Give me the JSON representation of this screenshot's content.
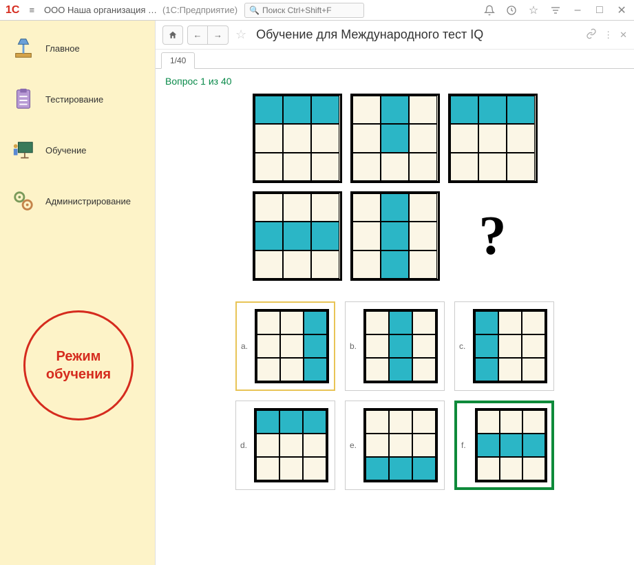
{
  "titlebar": {
    "logo": "1C",
    "org_title": "ООО Наша организация …",
    "app_suffix": "(1С:Предприятие)",
    "search_placeholder": "Поиск Ctrl+Shift+F"
  },
  "sidebar": {
    "items": [
      {
        "label": "Главное"
      },
      {
        "label": "Тестирование"
      },
      {
        "label": "Обучение"
      },
      {
        "label": "Администрирование"
      }
    ],
    "mode_badge_line1": "Режим",
    "mode_badge_line2": "обучения"
  },
  "toolbar": {
    "page_title": "Обучение для Международного тест IQ"
  },
  "tabs": {
    "active": "1/40"
  },
  "question": {
    "label": "Вопрос 1 из 40",
    "grids": [
      [
        1,
        1,
        1,
        0,
        0,
        0,
        0,
        0,
        0
      ],
      [
        0,
        1,
        0,
        0,
        1,
        0,
        0,
        0,
        0
      ],
      [
        1,
        1,
        1,
        0,
        0,
        0,
        0,
        0,
        0
      ],
      [
        0,
        0,
        0,
        1,
        1,
        1,
        0,
        0,
        0
      ],
      [
        0,
        1,
        0,
        0,
        1,
        0,
        0,
        1,
        0
      ]
    ],
    "unknown_symbol": "?"
  },
  "answers": [
    {
      "key": "a.",
      "grid": [
        0,
        0,
        1,
        0,
        0,
        1,
        0,
        0,
        1
      ],
      "highlight": "a"
    },
    {
      "key": "b.",
      "grid": [
        0,
        1,
        0,
        0,
        1,
        0,
        0,
        1,
        0
      ],
      "highlight": ""
    },
    {
      "key": "c.",
      "grid": [
        1,
        0,
        0,
        1,
        0,
        0,
        1,
        0,
        0
      ],
      "highlight": ""
    },
    {
      "key": "d.",
      "grid": [
        1,
        1,
        1,
        0,
        0,
        0,
        0,
        0,
        0
      ],
      "highlight": ""
    },
    {
      "key": "e.",
      "grid": [
        0,
        0,
        0,
        0,
        0,
        0,
        1,
        1,
        1
      ],
      "highlight": ""
    },
    {
      "key": "f.",
      "grid": [
        0,
        0,
        0,
        1,
        1,
        1,
        0,
        0,
        0
      ],
      "highlight": "f"
    }
  ],
  "colors": {
    "accent_red": "#d52b1e",
    "sidebar_bg": "#fdf3c8",
    "cell_on": "#2bb6c6",
    "correct_border": "#0e8a3a"
  }
}
